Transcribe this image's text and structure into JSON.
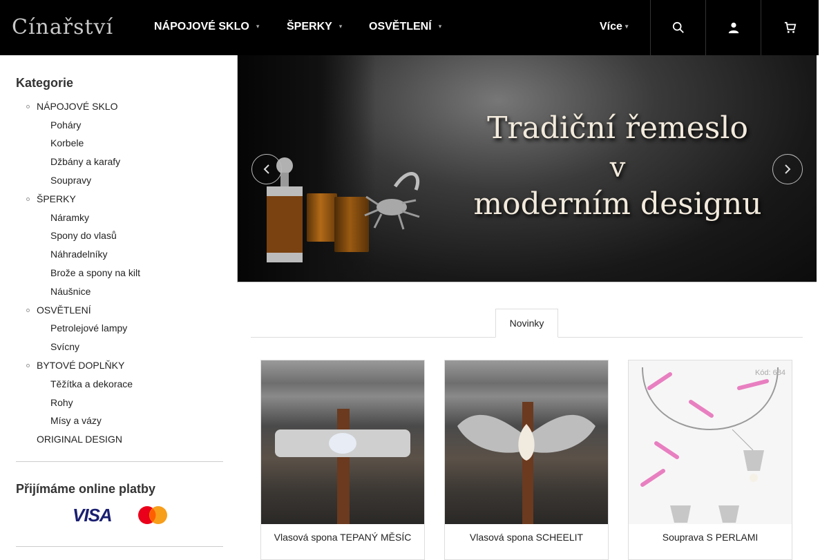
{
  "header": {
    "logo": "Cínařství",
    "nav": [
      {
        "label": "NÁPOJOVÉ SKLO"
      },
      {
        "label": "ŠPERKY"
      },
      {
        "label": "OSVĚTLENÍ"
      }
    ],
    "more_label": "Více",
    "icons": [
      "search-icon",
      "user-icon",
      "cart-icon"
    ]
  },
  "sidebar": {
    "title": "Kategorie",
    "categories": [
      {
        "label": "NÁPOJOVÉ SKLO",
        "level": 0
      },
      {
        "label": "Poháry",
        "level": 1
      },
      {
        "label": "Korbele",
        "level": 1
      },
      {
        "label": "Džbány a karafy",
        "level": 1
      },
      {
        "label": "Soupravy",
        "level": 1
      },
      {
        "label": "ŠPERKY",
        "level": 0
      },
      {
        "label": "Náramky",
        "level": 1
      },
      {
        "label": "Spony do vlasů",
        "level": 1
      },
      {
        "label": "Náhradelníky",
        "level": 1
      },
      {
        "label": "Brože a spony na kilt",
        "level": 1
      },
      {
        "label": "Náušnice",
        "level": 1
      },
      {
        "label": "OSVĚTLENÍ",
        "level": 0
      },
      {
        "label": "Petrolejové lampy",
        "level": 1
      },
      {
        "label": "Svícny",
        "level": 1
      },
      {
        "label": "BYTOVÉ DOPLŇKY",
        "level": 0
      },
      {
        "label": "Těžítka a dekorace",
        "level": 1
      },
      {
        "label": "Rohy",
        "level": 1
      },
      {
        "label": "Mísy a vázy",
        "level": 1
      },
      {
        "label": "ORIGINAL DESIGN",
        "level": 0
      }
    ],
    "payments_title": "Přijímáme online platby",
    "payment_brands": [
      "VISA"
    ]
  },
  "banner": {
    "lines": [
      "Tradiční řemeslo",
      "v",
      "moderním designu"
    ],
    "prev_icon": "chevron-left-icon",
    "next_icon": "chevron-right-icon"
  },
  "tabs": [
    {
      "label": "Novinky",
      "active": true
    }
  ],
  "products": [
    {
      "name": "Vlasová spona TEPANÝ MĚSÍC",
      "code": ""
    },
    {
      "name": "Vlasová spona SCHEELIT",
      "code": ""
    },
    {
      "name": "Souprava S PERLAMI",
      "code": "Kód: 684"
    }
  ],
  "colors": {
    "header_bg": "#000000",
    "banner_text": "#f2eadc",
    "visa_blue": "#1a1f71"
  }
}
